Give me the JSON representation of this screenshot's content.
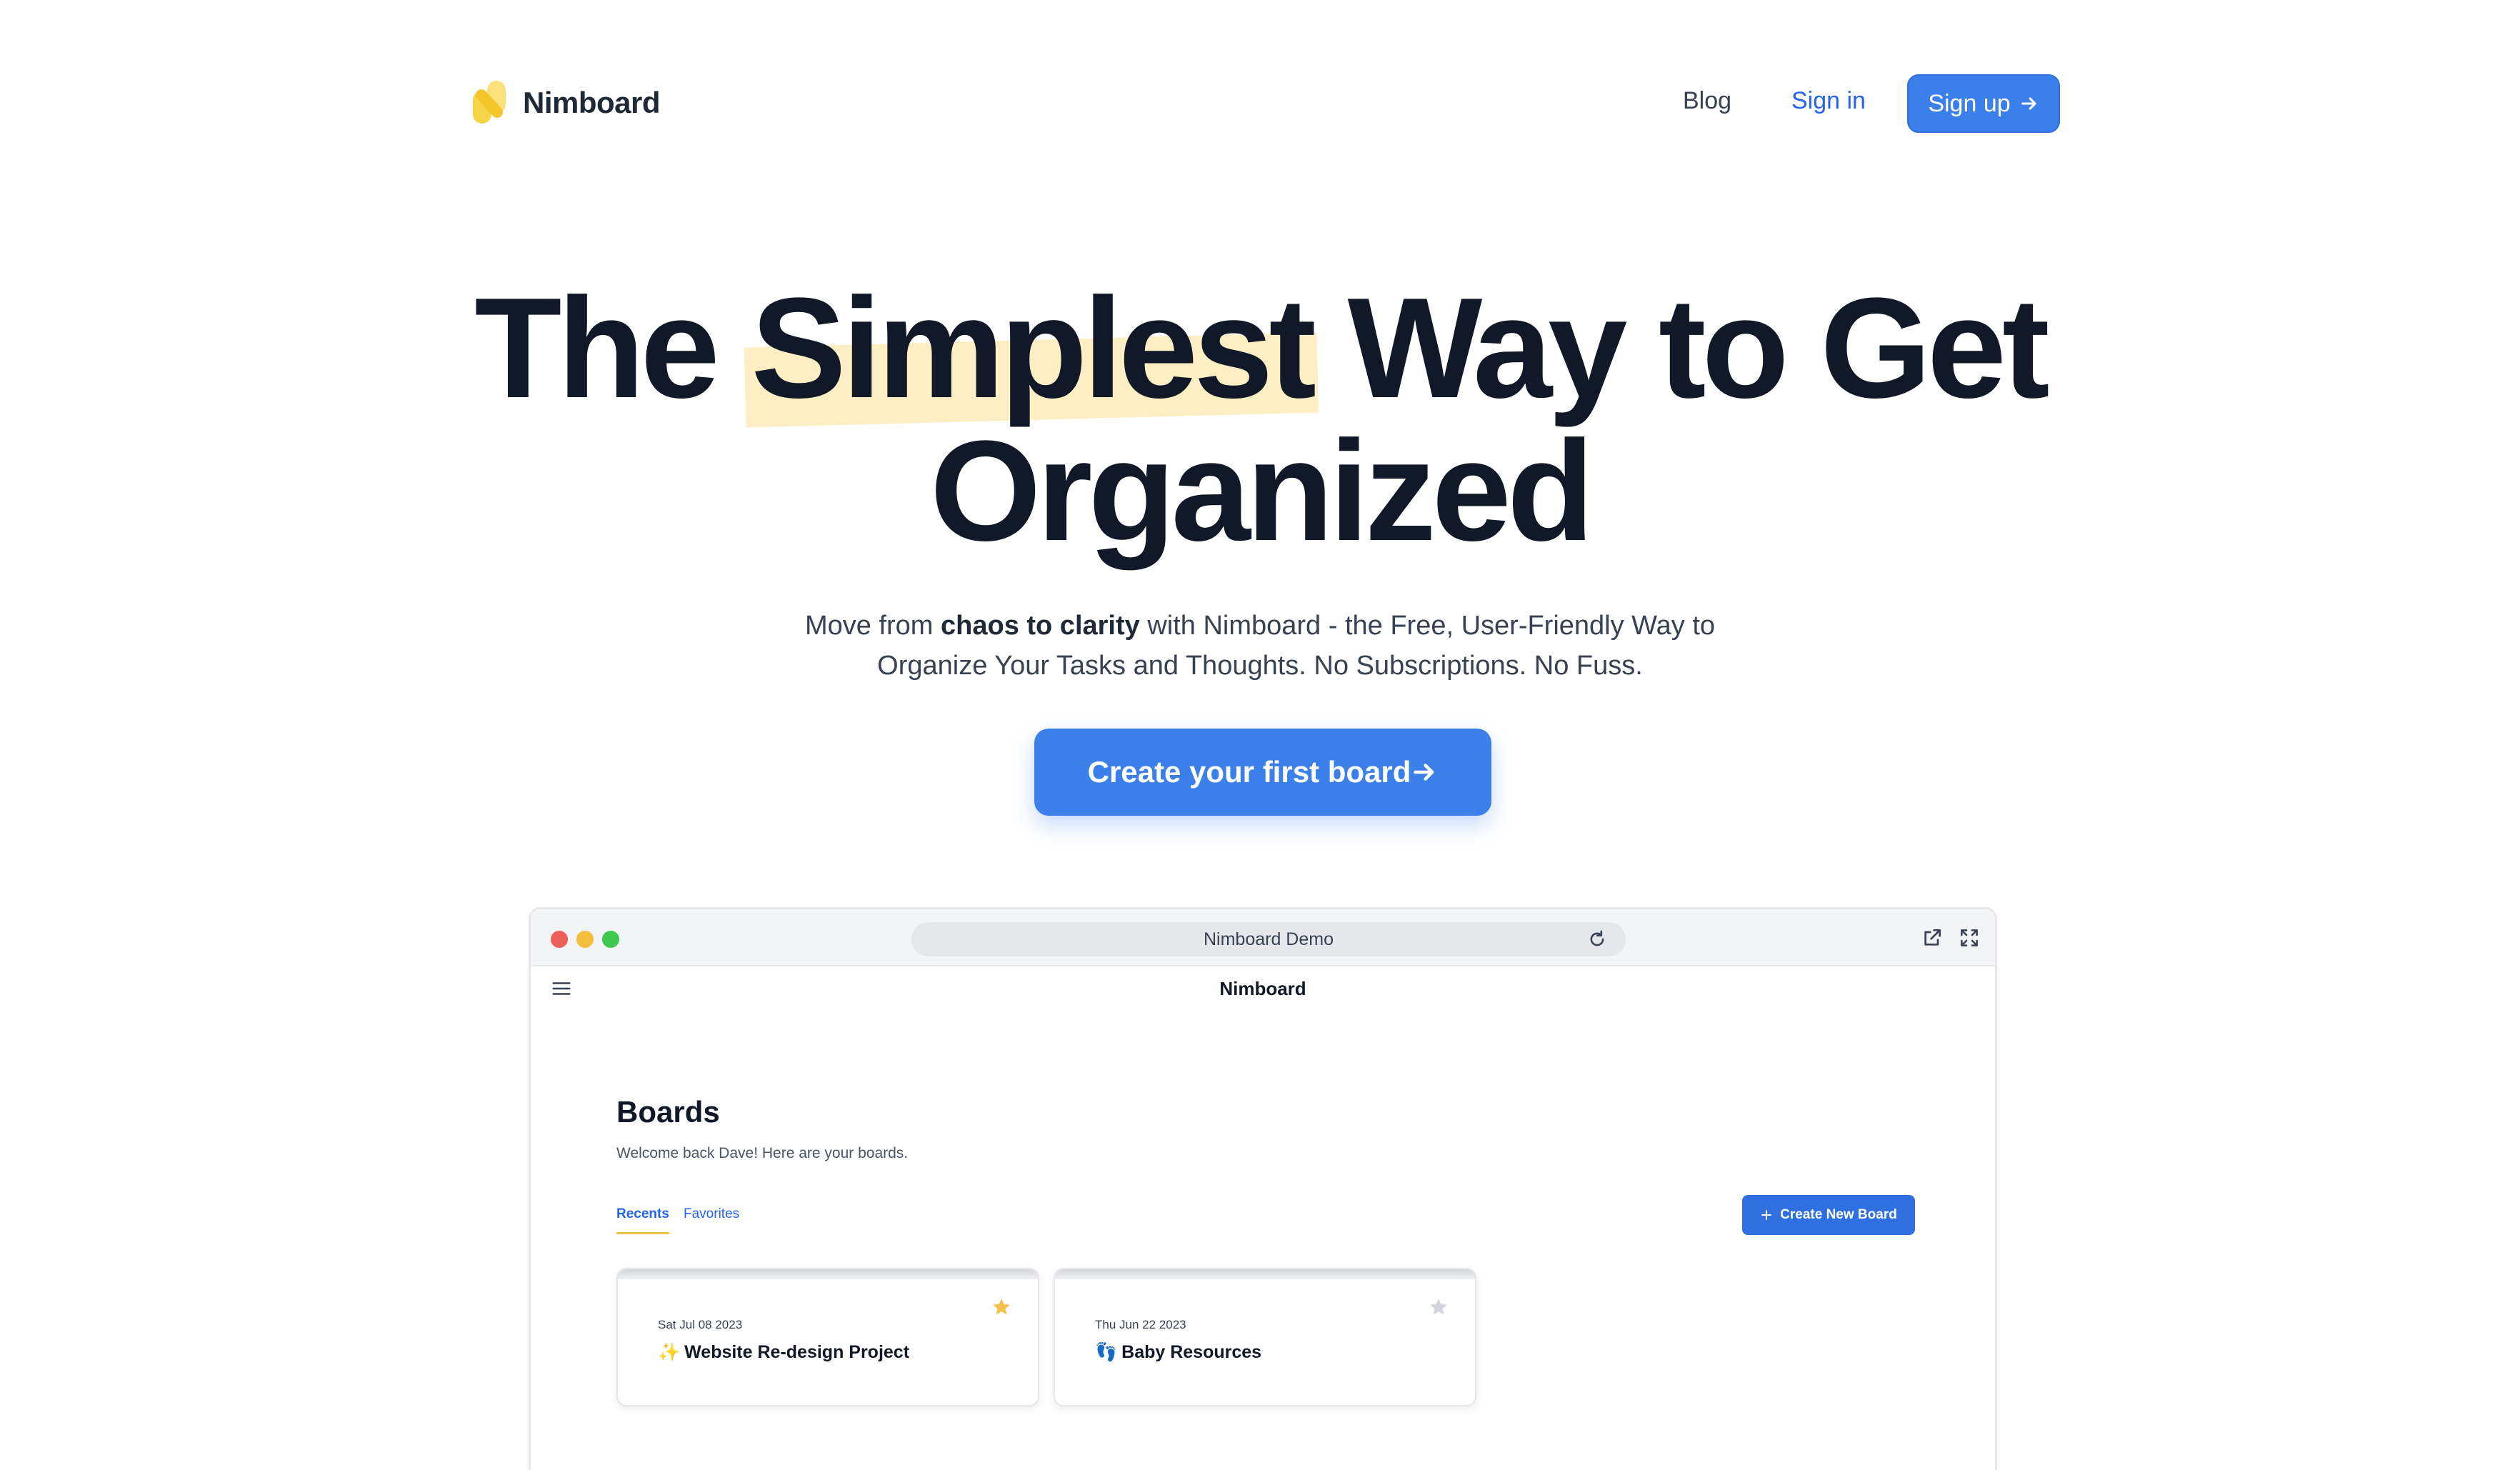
{
  "header": {
    "logo_text": "Nimboard",
    "nav": {
      "blog": "Blog",
      "sign_in": "Sign in",
      "sign_up": "Sign up"
    }
  },
  "hero": {
    "title_part1": "The ",
    "title_highlight": "Simplest",
    "title_part2": " Way to Get",
    "title_line2": "Organized",
    "subtitle_pre": "Move from ",
    "subtitle_bold": "chaos to clarity",
    "subtitle_post": " with Nimboard - the Free, User-Friendly Way to",
    "subtitle_line2": "Organize Your Tasks and Thoughts. No Subscriptions. No Fuss.",
    "cta_label": "Create your first board"
  },
  "demo": {
    "url_label": "Nimboard Demo",
    "app_title": "Nimboard",
    "boards_title": "Boards",
    "boards_subtitle": "Welcome back Dave! Here are your boards.",
    "tabs": [
      "Recents",
      "Favorites"
    ],
    "create_button": "Create New Board",
    "cards": [
      {
        "date": "Sat Jul 08 2023",
        "emoji": "✨",
        "name": "Website Re-design Project",
        "favorite": true
      },
      {
        "date": "Thu Jun 22 2023",
        "emoji": "👣",
        "name": "Baby Resources",
        "favorite": false
      }
    ]
  },
  "colors": {
    "accent": "#3b7fea",
    "highlight": "#fdefc3",
    "star_active": "#f3c04a",
    "star_inactive": "#d1d5db",
    "tab_underline": "#f3c04a"
  },
  "icons": [
    "logo-mark-icon",
    "arrow-right-icon",
    "reload-icon",
    "external-link-icon",
    "fullscreen-icon",
    "menu-icon",
    "plus-icon",
    "star-icon"
  ]
}
